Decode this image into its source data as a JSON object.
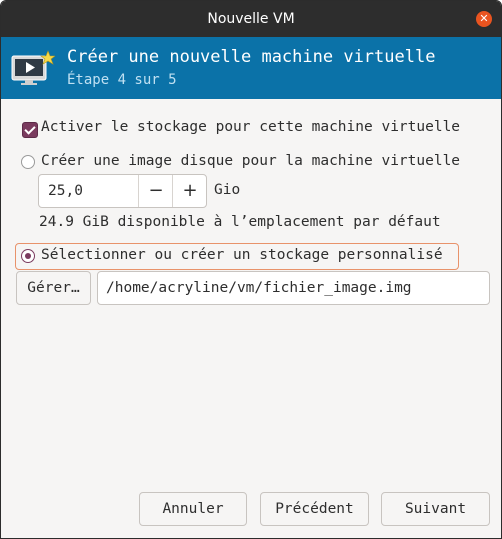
{
  "window": {
    "title": "Nouvelle VM"
  },
  "banner": {
    "heading": "Créer une nouvelle machine virtuelle",
    "step": "Étape 4 sur 5"
  },
  "storage": {
    "enable_label": "Activer le stockage pour cette machine virtuelle",
    "enable_checked": true,
    "create_image_label": "Créer une image disque pour la machine virtuelle",
    "create_image_selected": false,
    "size_value": "25,0",
    "size_unit": "Gio",
    "minus_label": "−",
    "plus_label": "+",
    "available_text": "24.9 GiB disponible à l’emplacement par défaut",
    "custom_label": "Sélectionner ou créer un stockage personnalisé",
    "custom_selected": true,
    "manage_label": "Gérer…",
    "path_value": "/home/acryline/vm/fichier_image.img"
  },
  "footer": {
    "cancel_label": "Annuler",
    "back_label": "Précédent",
    "next_label": "Suivant"
  },
  "colors": {
    "banner": "#0b72a8",
    "accent": "#7a3b5e",
    "focus": "#e8926a",
    "close": "#e95420"
  },
  "icons": {
    "close": "close-icon",
    "vm": "vm-monitor-icon"
  }
}
